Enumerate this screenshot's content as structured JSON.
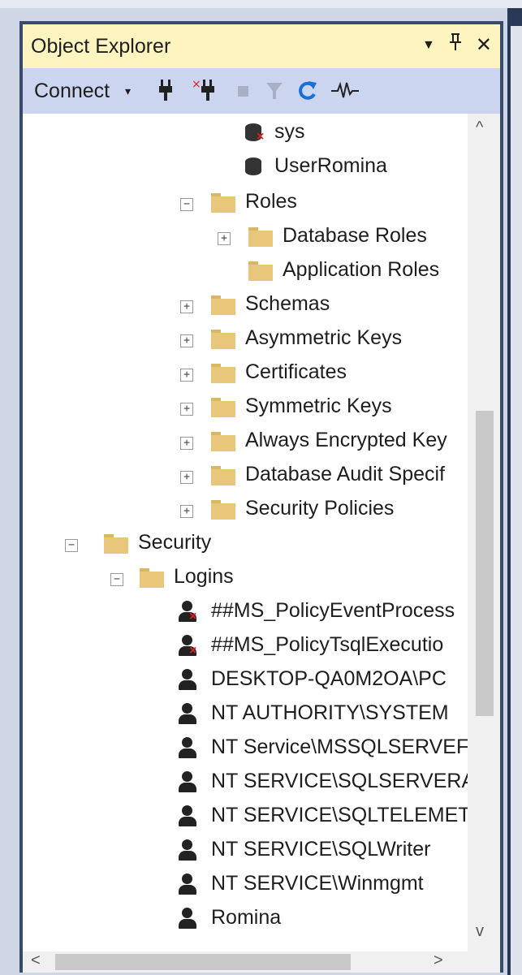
{
  "panel": {
    "title": "Object Explorer",
    "header_icons": {
      "dropdown": "▼",
      "pin": "⊥",
      "close": "✕"
    },
    "toolbar": {
      "connect_label": "Connect",
      "connect_caret": "▾",
      "tools": [
        "plug-icon",
        "disconnect-icon",
        "stop-icon",
        "filter-icon",
        "refresh-icon",
        "activity-monitor-icon"
      ]
    }
  },
  "tree": {
    "rows": [
      {
        "label": "sys",
        "icon": "db-user-disabled-icon",
        "expander": ""
      },
      {
        "label": "UserRomina",
        "icon": "db-user-icon",
        "expander": ""
      },
      {
        "label": "Roles",
        "icon": "folder-icon",
        "expander": "−"
      },
      {
        "label": "Database Roles",
        "icon": "folder-icon",
        "expander": "+"
      },
      {
        "label": "Application Roles",
        "icon": "folder-icon",
        "expander": ""
      },
      {
        "label": "Schemas",
        "icon": "folder-icon",
        "expander": "+"
      },
      {
        "label": "Asymmetric Keys",
        "icon": "folder-icon",
        "expander": "+"
      },
      {
        "label": "Certificates",
        "icon": "folder-icon",
        "expander": "+"
      },
      {
        "label": "Symmetric Keys",
        "icon": "folder-icon",
        "expander": "+"
      },
      {
        "label": "Always Encrypted Key",
        "icon": "folder-icon",
        "expander": "+"
      },
      {
        "label": "Database Audit Specif",
        "icon": "folder-icon",
        "expander": "+"
      },
      {
        "label": "Security Policies",
        "icon": "folder-icon",
        "expander": "+"
      },
      {
        "label": "Security",
        "icon": "folder-icon",
        "expander": "−"
      },
      {
        "label": "Logins",
        "icon": "folder-icon",
        "expander": "−"
      },
      {
        "label": "##MS_PolicyEventProcess",
        "icon": "login-disabled-icon",
        "expander": ""
      },
      {
        "label": "##MS_PolicyTsqlExecutio",
        "icon": "login-disabled-icon",
        "expander": ""
      },
      {
        "label": "DESKTOP-QA0M2OA\\PC",
        "icon": "login-icon",
        "expander": ""
      },
      {
        "label": "NT AUTHORITY\\SYSTEM",
        "icon": "login-icon",
        "expander": ""
      },
      {
        "label": "NT Service\\MSSQLSERVEF",
        "icon": "login-icon",
        "expander": ""
      },
      {
        "label": "NT SERVICE\\SQLSERVERA",
        "icon": "login-icon",
        "expander": ""
      },
      {
        "label": "NT SERVICE\\SQLTELEMET",
        "icon": "login-icon",
        "expander": ""
      },
      {
        "label": "NT SERVICE\\SQLWriter",
        "icon": "login-icon",
        "expander": ""
      },
      {
        "label": "NT SERVICE\\Winmgmt",
        "icon": "login-icon",
        "expander": ""
      },
      {
        "label": "Romina",
        "icon": "login-icon",
        "expander": ""
      }
    ]
  },
  "scrollbars": {
    "up": "^",
    "down": "v",
    "left": "<",
    "right": ">"
  },
  "colors": {
    "title_bg": "#fdf4bf",
    "toolbar_bg": "#ccd5f0",
    "frame": "#3a4a6b",
    "folder": "#e8c77a",
    "disabled_x": "#e02020",
    "refresh": "#1a6fd6"
  }
}
